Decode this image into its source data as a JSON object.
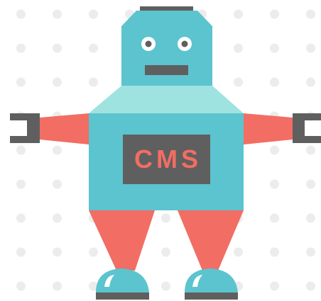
{
  "badge": {
    "text": "CMS"
  },
  "colors": {
    "background": "#ffffff",
    "dots": "#ececec",
    "teal": "#5bc4cf",
    "teal_light": "#9fe3e0",
    "coral": "#f26d63",
    "dark_gray": "#5f5f5f",
    "white": "#ffffff"
  },
  "icons": {
    "left_hand": "claw-icon",
    "right_hand": "claw-icon",
    "left_shoe": "shoe-icon",
    "right_shoe": "shoe-icon"
  }
}
